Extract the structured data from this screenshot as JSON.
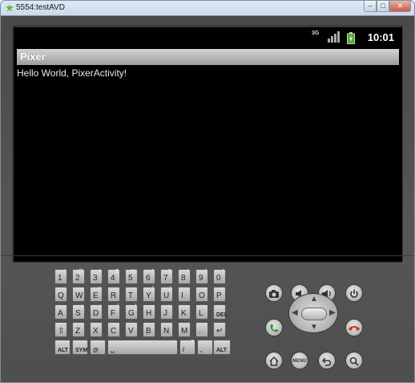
{
  "window": {
    "title": "5554:testAVD",
    "min": "–",
    "max": "□",
    "close": "✕"
  },
  "status_bar": {
    "data_label": "3G",
    "time": "10:01"
  },
  "app": {
    "title": "Pixer",
    "content": "Hello World, PixerActivity!"
  },
  "keyboard": {
    "row1": [
      {
        "m": "1",
        "a": "!"
      },
      {
        "m": "2",
        "a": "@"
      },
      {
        "m": "3",
        "a": "#"
      },
      {
        "m": "4",
        "a": "$"
      },
      {
        "m": "5",
        "a": "%"
      },
      {
        "m": "6",
        "a": "^"
      },
      {
        "m": "7",
        "a": "&"
      },
      {
        "m": "8",
        "a": "*"
      },
      {
        "m": "9",
        "a": "("
      },
      {
        "m": "0",
        "a": ")"
      }
    ],
    "row2": [
      {
        "m": "Q",
        "a": ""
      },
      {
        "m": "W",
        "a": "~"
      },
      {
        "m": "E",
        "a": "\""
      },
      {
        "m": "R",
        "a": ""
      },
      {
        "m": "T",
        "a": ""
      },
      {
        "m": "Y",
        "a": "{"
      },
      {
        "m": "U",
        "a": "}"
      },
      {
        "m": "I",
        "a": "-"
      },
      {
        "m": "O",
        "a": "+"
      },
      {
        "m": "P",
        "a": "="
      }
    ],
    "row3": [
      {
        "m": "A",
        "a": ""
      },
      {
        "m": "S",
        "a": "\\"
      },
      {
        "m": "D",
        "a": "'"
      },
      {
        "m": "F",
        "a": "["
      },
      {
        "m": "G",
        "a": "]"
      },
      {
        "m": "H",
        "a": "<"
      },
      {
        "m": "J",
        "a": ">"
      },
      {
        "m": "K",
        "a": ";"
      },
      {
        "m": "L",
        "a": ":"
      },
      {
        "m": "DEL",
        "a": ""
      }
    ],
    "row4": [
      {
        "m": "⇧",
        "a": ""
      },
      {
        "m": "Z",
        "a": ""
      },
      {
        "m": "X",
        "a": ""
      },
      {
        "m": "C",
        "a": ""
      },
      {
        "m": "V",
        "a": ""
      },
      {
        "m": "B",
        "a": ""
      },
      {
        "m": "N",
        "a": ""
      },
      {
        "m": "M",
        "a": ""
      },
      {
        "m": ".",
        "a": ""
      },
      {
        "m": "↵",
        "a": ""
      }
    ],
    "row5": {
      "alt_left": "ALT",
      "sym": "SYM",
      "at": "@",
      "space": "␣",
      "slash": "/",
      "question": "?",
      "comma": ",",
      "alt_right": "ALT"
    }
  },
  "controls": {
    "menu_label": "MENU"
  },
  "icons": {
    "camera": "camera-icon",
    "volume_down": "volume-down-icon",
    "volume_up": "volume-up-icon",
    "power": "power-icon",
    "call": "call-icon",
    "end_call": "end-call-icon",
    "home": "home-icon",
    "back": "back-icon",
    "search": "search-icon"
  },
  "colors": {
    "call": "#2e9b2e",
    "end_call": "#d03020",
    "screen": "#000000",
    "chassis": "#4d4d4d"
  }
}
